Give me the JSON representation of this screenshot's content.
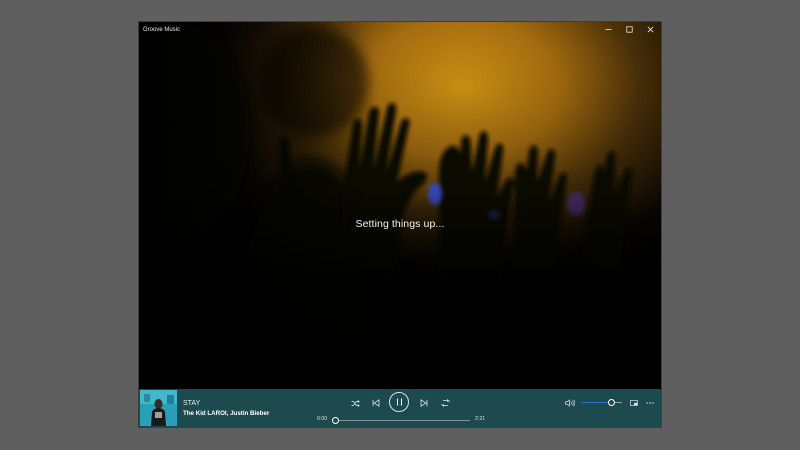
{
  "window": {
    "title": "Groove Music"
  },
  "main": {
    "status_text": "Setting things up..."
  },
  "now_playing": {
    "title": "STAY",
    "artist": "The Kid LAROI, Justin Bieber",
    "elapsed": "0:00",
    "duration": "2:21",
    "progress": 0.0,
    "volume": 0.72
  },
  "icons": {
    "minimize": "minimize-icon",
    "maximize": "maximize-icon",
    "close": "close-icon",
    "shuffle": "shuffle-icon",
    "previous": "previous-icon",
    "pause": "pause-icon",
    "next": "next-icon",
    "repeat": "repeat-icon",
    "volume": "volume-icon",
    "mini_view": "mini-view-icon",
    "more": "more-icon"
  },
  "colors": {
    "player_bar": "#1d4a4f",
    "accent": "#2f6ee0",
    "background_glow": "#c98a12"
  }
}
